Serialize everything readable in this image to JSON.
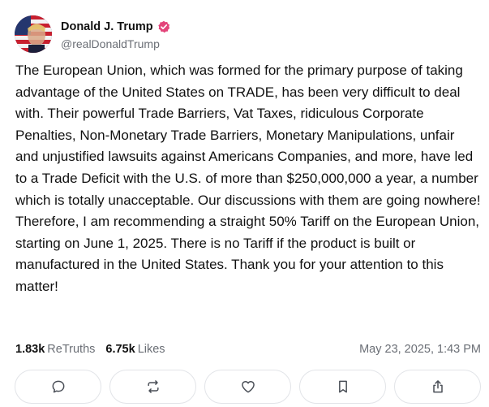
{
  "author": {
    "display_name": "Donald J. Trump",
    "handle": "@realDonaldTrump",
    "avatar_icon": "user-avatar",
    "verified_icon": "verified-badge-icon",
    "verified_color": "#e3447a"
  },
  "post": {
    "text": "The European Union, which was formed for the primary purpose of taking advantage of the United States on TRADE, has been very difficult to deal with. Their powerful Trade Barriers, Vat Taxes, ridiculous Corporate Penalties, Non-Monetary Trade Barriers, Monetary Manipulations, unfair and unjustified lawsuits against Americans Companies, and more, have led to a Trade Deficit with the U.S. of more than $250,000,000 a year, a number which is totally unacceptable. Our discussions with them are going nowhere! Therefore, I am recommending a straight 50% Tariff on the European Union, starting on June 1, 2025. There is no Tariff if the product is built or manufactured in the United States. Thank you for your attention to this matter!"
  },
  "stats": {
    "retruths_count": "1.83k",
    "retruths_label": "ReTruths",
    "likes_count": "6.75k",
    "likes_label": "Likes",
    "timestamp": "May 23, 2025, 1:43 PM"
  },
  "actions": [
    {
      "icon": "reply-icon"
    },
    {
      "icon": "retruth-icon"
    },
    {
      "icon": "like-icon"
    },
    {
      "icon": "bookmark-icon"
    },
    {
      "icon": "share-icon"
    }
  ],
  "colors": {
    "text": "#111111",
    "muted": "#6b6f76",
    "border": "#e2e4e8"
  }
}
